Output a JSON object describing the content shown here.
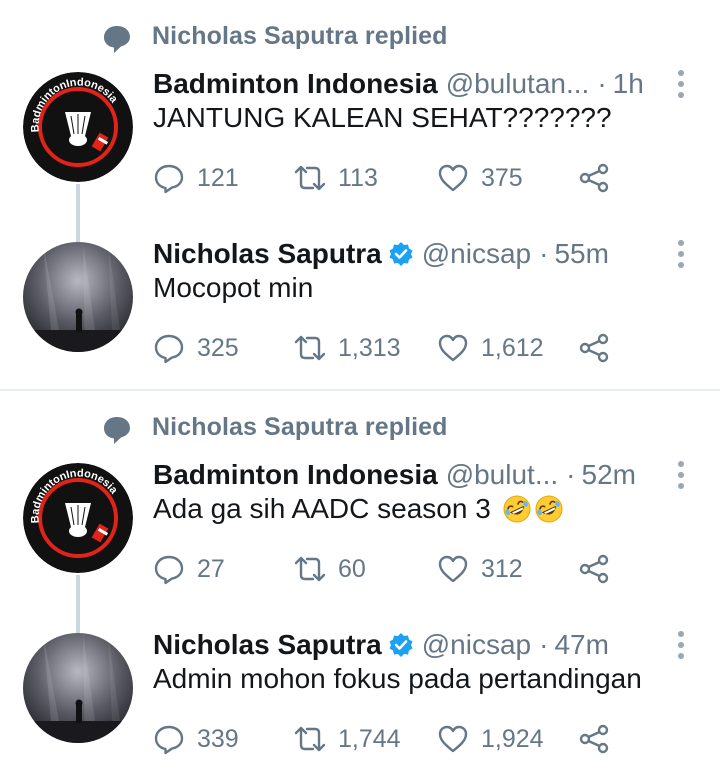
{
  "colors": {
    "text": "#14171a",
    "muted": "#657786",
    "verified": "#1da1f2",
    "badminton_red": "#e2231a"
  },
  "threads": [
    {
      "context": {
        "icon": "speech-bubble-icon",
        "text": "Nicholas Saputra replied"
      },
      "tweets": [
        {
          "name": "Badminton Indonesia",
          "handle": "@bulutan...",
          "time": "1h",
          "verified": false,
          "text": "JANTUNG KALEAN SEHAT???????",
          "replies": "121",
          "retweets": "113",
          "likes": "375"
        },
        {
          "name": "Nicholas Saputra",
          "handle": "@nicsap",
          "time": "55m",
          "verified": true,
          "text": "Mocopot min",
          "replies": "325",
          "retweets": "1,313",
          "likes": "1,612"
        }
      ]
    },
    {
      "context": {
        "icon": "speech-bubble-icon",
        "text": "Nicholas Saputra replied"
      },
      "tweets": [
        {
          "name": "Badminton Indonesia",
          "handle": "@bulut...",
          "time": "52m",
          "verified": false,
          "text": "Ada ga sih AADC season 3",
          "emojis": [
            "rolling-laughing-emoji",
            "rolling-laughing-emoji"
          ],
          "replies": "27",
          "retweets": "60",
          "likes": "312"
        },
        {
          "name": "Nicholas Saputra",
          "handle": "@nicsap",
          "time": "47m",
          "verified": true,
          "text": "Admin mohon fokus pada pertandingan",
          "replies": "339",
          "retweets": "1,744",
          "likes": "1,924"
        }
      ]
    }
  ],
  "avatar_logo_text": "Badminton Indonesia"
}
